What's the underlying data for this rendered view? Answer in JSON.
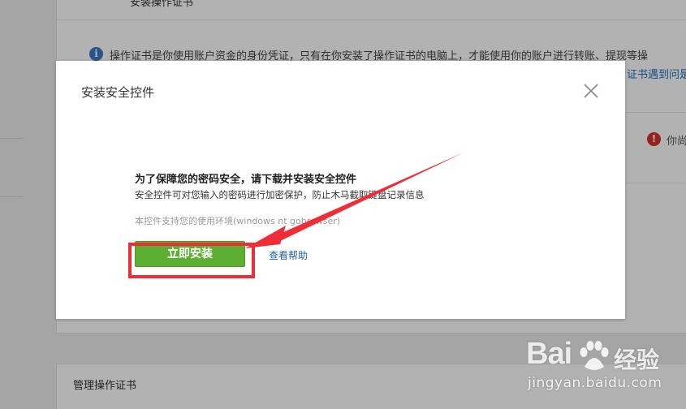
{
  "background": {
    "section_title": "安装操作证书",
    "info_text": "操作证书是你使用账户资金的身份凭证，只有在你安装了操作证书的电脑上，才能使用你的账户进行转账、提现等操",
    "info_link": "证书遇到问是",
    "warning_text": "你尚",
    "manage_title": "管理操作证书"
  },
  "modal": {
    "title": "安装安全控件",
    "heading": "为了保障您的密码安全，请下载并安装安全控件",
    "description": "安全控件可对您输入的密码进行加密保护，防止木马截取键盘记录信息",
    "environment": "本控件支持您的使用环境(windows nt gobrowser)",
    "install_label": "立即安装",
    "help_label": "查看帮助"
  },
  "watermark": {
    "logo": "Bai",
    "brand_cn": "经验",
    "url": "jingyan.baidu.com"
  },
  "colors": {
    "install_green": "#5daf34",
    "annotation_red": "#ee2d36",
    "link_blue": "#1f5fa8"
  }
}
